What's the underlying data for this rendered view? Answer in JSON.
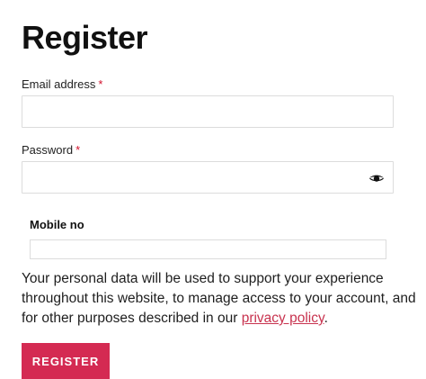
{
  "page": {
    "title": "Register"
  },
  "form": {
    "email_label": "Email address",
    "email_required": "*",
    "email_value": "",
    "password_label": "Password",
    "password_required": "*",
    "password_value": "",
    "mobile_label": "Mobile no",
    "mobile_value": ""
  },
  "privacy": {
    "text_before": "Your personal data will be used to support your experience throughout this website, to manage access to your account, and for other purposes described in our ",
    "link_text": "privacy policy",
    "text_after": "."
  },
  "actions": {
    "register_label": "Register"
  },
  "colors": {
    "accent": "#d42a52",
    "link": "#c8334f",
    "required": "#d2112c"
  },
  "icons": {
    "password_toggle": "eye-icon"
  }
}
